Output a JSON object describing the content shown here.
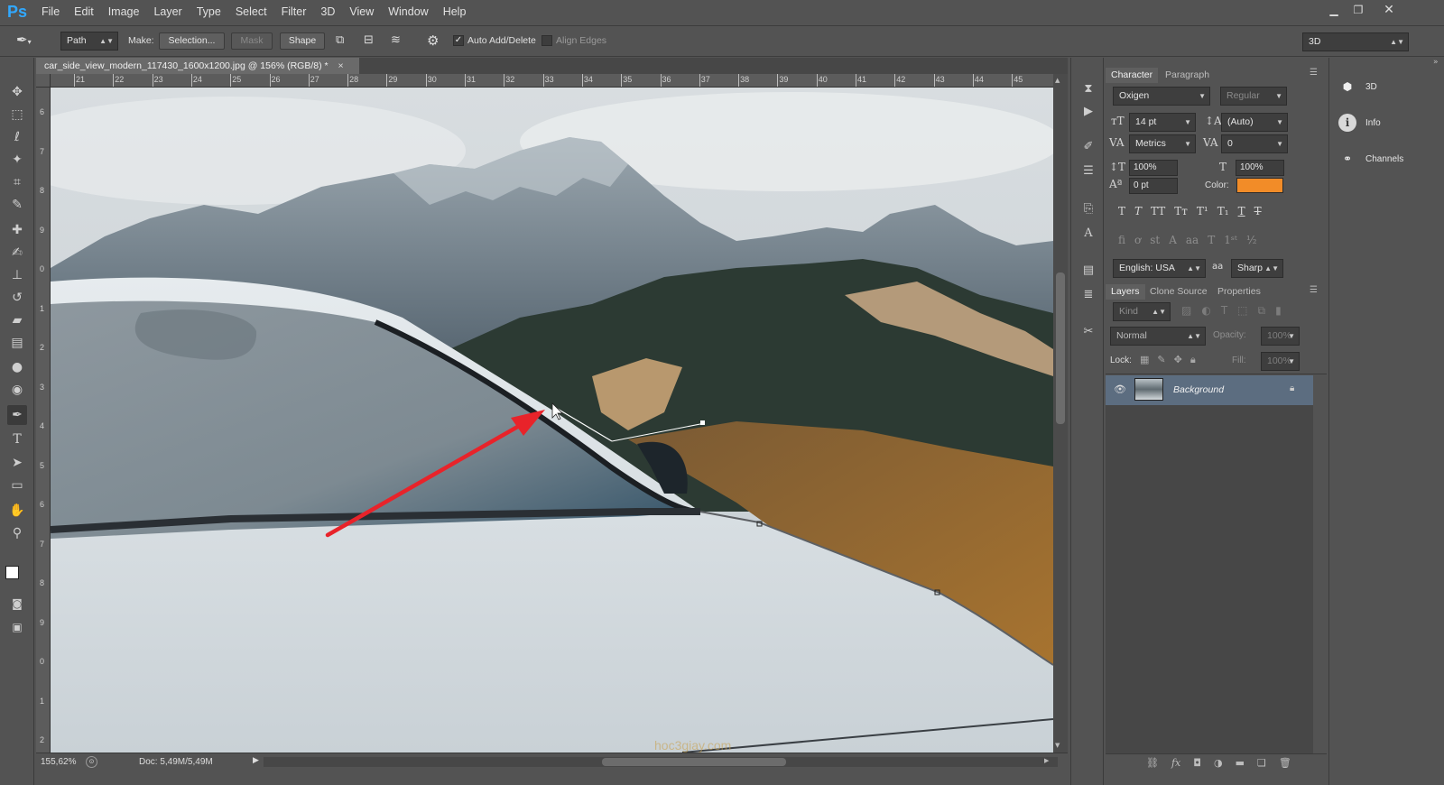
{
  "app": {
    "logo": "Ps",
    "menu": [
      "File",
      "Edit",
      "Image",
      "Layer",
      "Type",
      "Select",
      "Filter",
      "3D",
      "View",
      "Window",
      "Help"
    ]
  },
  "options": {
    "tool_mode": "Path",
    "make_label": "Make:",
    "selection_label": "Selection...",
    "mask_label": "Mask",
    "shape_label": "Shape",
    "auto_add_delete": "Auto Add/Delete",
    "align_edges": "Align Edges",
    "workspace": "3D"
  },
  "document": {
    "tab_title": "car_side_view_modern_117430_1600x1200.jpg @ 156% (RGB/8) *",
    "close_glyph": "×"
  },
  "ruler": {
    "h_ticks": [
      "21",
      "22",
      "23",
      "24",
      "25",
      "26",
      "27",
      "28",
      "29",
      "30",
      "31",
      "32",
      "33",
      "34",
      "35",
      "36",
      "37",
      "38",
      "39",
      "40",
      "41",
      "42",
      "43",
      "44",
      "45"
    ],
    "v_ticks": [
      "6",
      "7",
      "8",
      "9",
      "0",
      "1",
      "2",
      "3",
      "4",
      "5",
      "6",
      "7",
      "8",
      "9",
      "0",
      "1",
      "2"
    ]
  },
  "status": {
    "zoom": "155,62%",
    "doc": "Doc: 5,49M/5,49M",
    "watermark": "hoc3giay.com"
  },
  "character": {
    "tabs": [
      "Character",
      "Paragraph"
    ],
    "font_family": "Oxigen",
    "font_style": "Regular",
    "font_size": "14 pt",
    "leading": "(Auto)",
    "kerning": "Metrics",
    "tracking": "0",
    "vscale": "100%",
    "hscale": "100%",
    "baseline": "0 pt",
    "color_label": "Color:",
    "color": "#f28c28",
    "language": "English: USA",
    "antialias_icon": "aa",
    "antialias": "Sharp"
  },
  "layers": {
    "tabs": [
      "Layers",
      "Clone Source",
      "Properties"
    ],
    "kind": "Kind",
    "blend": "Normal",
    "opacity_label": "Opacity:",
    "opacity": "100%",
    "lock_label": "Lock:",
    "fill_label": "Fill:",
    "fill": "100%",
    "layer_name": "Background"
  },
  "right_strip": {
    "items": [
      "3D",
      "Info",
      "Channels"
    ]
  },
  "colors": {
    "accent_arrow": "#e8232a",
    "ps_blue": "#31a8ff"
  }
}
